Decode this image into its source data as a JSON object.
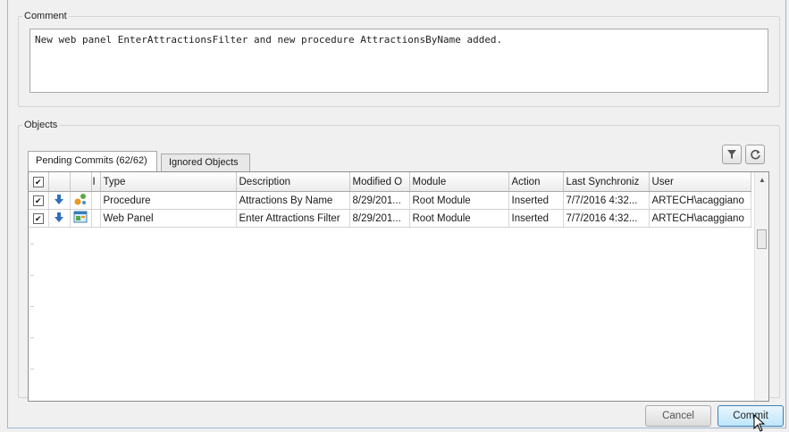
{
  "comment": {
    "legend": "Comment",
    "text": "New web panel EnterAttractionsFilter and new procedure AttractionsByName added."
  },
  "objects": {
    "legend": "Objects",
    "tabs": [
      {
        "label": "Pending Commits (62/62)",
        "active": true
      },
      {
        "label": "Ignored Objects",
        "active": false
      }
    ],
    "toolbar": {
      "filter_icon": "filter-icon",
      "refresh_icon": "refresh-icon"
    },
    "columns": [
      "",
      "",
      "",
      "I",
      "Type",
      "Description",
      "Modified O",
      "Module",
      "Action",
      "Last Synchroniz",
      "User"
    ],
    "rows": [
      {
        "checked": true,
        "status_icon": "commit-arrow-icon",
        "type_icon": "procedure-icon",
        "type": "Procedure",
        "description": "Attractions By Name",
        "modified": "8/29/201...",
        "module": "Root Module",
        "action": "Inserted",
        "last_sync": "7/7/2016 4:32...",
        "user": "ARTECH\\acaggiano"
      },
      {
        "checked": true,
        "status_icon": "commit-arrow-icon",
        "type_icon": "web-panel-icon",
        "type": "Web Panel",
        "description": "Enter Attractions Filter",
        "modified": "8/29/201...",
        "module": "Root Module",
        "action": "Inserted",
        "last_sync": "7/7/2016 4:32...",
        "user": "ARTECH\\acaggiano"
      }
    ]
  },
  "buttons": {
    "cancel": "Cancel",
    "commit": "Commit"
  },
  "colors": {
    "accent_button_border": "#3c7fb1",
    "window_border": "#9fb7cf"
  }
}
